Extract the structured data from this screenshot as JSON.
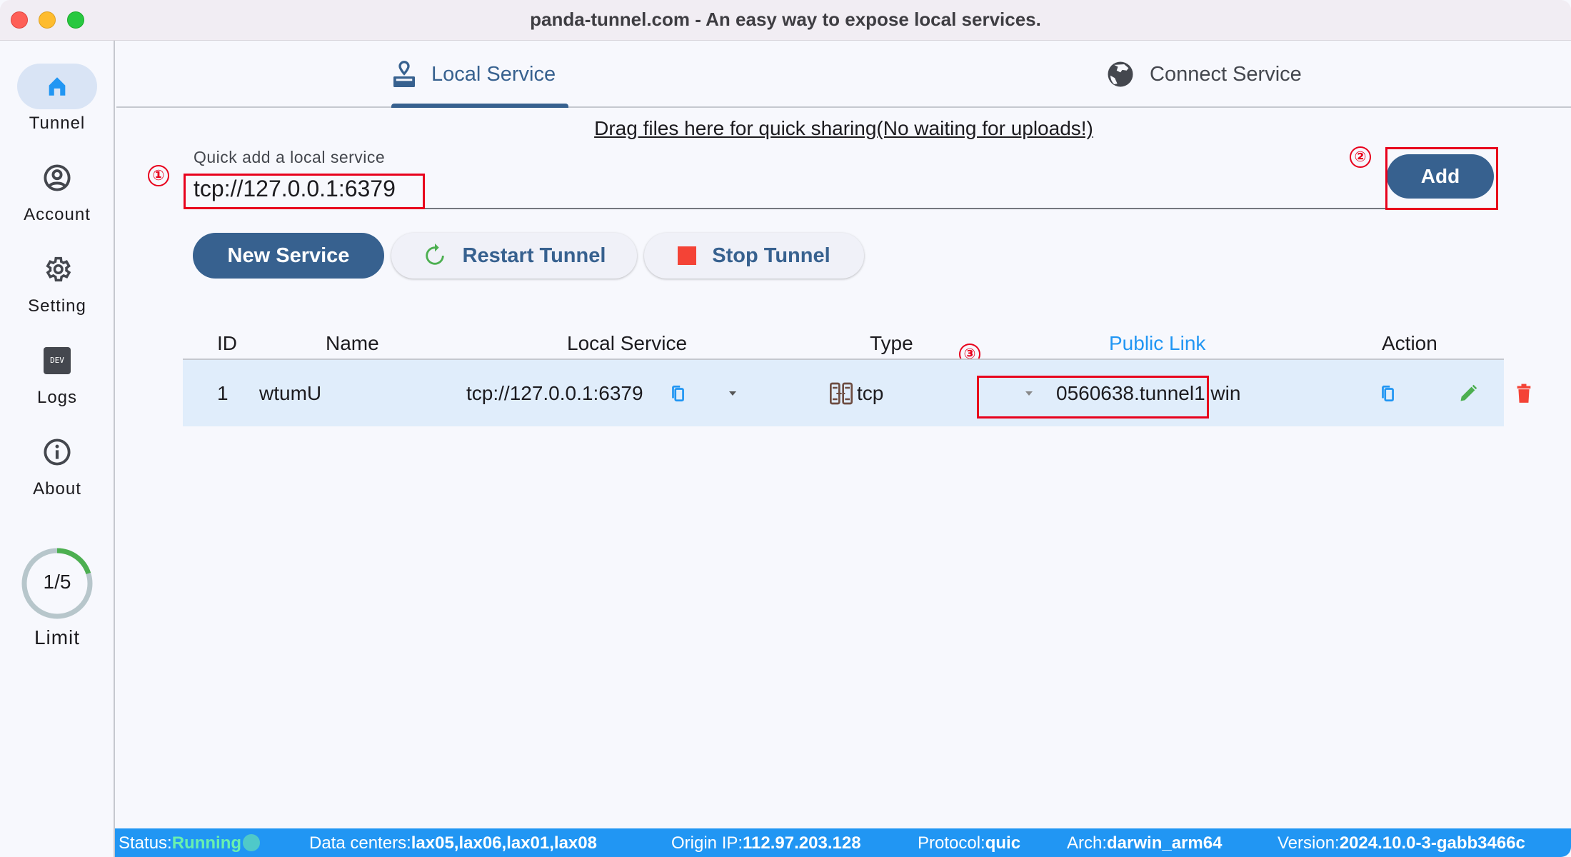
{
  "window": {
    "title": "panda-tunnel.com - An easy way to expose local services."
  },
  "sidebar": {
    "items": [
      {
        "label": "Tunnel",
        "icon": "home-icon",
        "active": true
      },
      {
        "label": "Account",
        "icon": "account-circle-icon",
        "active": false
      },
      {
        "label": "Setting",
        "icon": "gear-icon",
        "active": false
      },
      {
        "label": "Logs",
        "icon": "dev-icon",
        "active": false,
        "icon_text": "DEV"
      },
      {
        "label": "About",
        "icon": "info-icon",
        "active": false
      }
    ],
    "limit": {
      "text": "1/5",
      "label": "Limit",
      "used": 1,
      "total": 5
    }
  },
  "tabs": [
    {
      "label": "Local Service",
      "icon": "stamp-pin-icon",
      "active": true
    },
    {
      "label": "Connect Service",
      "icon": "globe-icon",
      "active": false
    }
  ],
  "drag_text": "Drag files here for quick sharing(No waiting for uploads!)",
  "quick_add": {
    "label": "Quick add a local service",
    "value": "tcp://127.0.0.1:6379",
    "add_label": "Add"
  },
  "markers": [
    "①",
    "②",
    "③"
  ],
  "actions": {
    "new_service": "New Service",
    "restart_tunnel": "Restart Tunnel",
    "stop_tunnel": "Stop Tunnel"
  },
  "table": {
    "columns": [
      "ID",
      "Name",
      "Local Service",
      "Type",
      "Public Link",
      "Action"
    ],
    "rows": [
      {
        "id": "1",
        "name": "wtumU",
        "local_service": "tcp://127.0.0.1:6379",
        "type": "tcp",
        "public_link": "0560638.tunnel1.win"
      }
    ]
  },
  "status_bar": {
    "status_label": "Status:",
    "status_value": "Running",
    "data_centers_label": "Data centers:",
    "data_centers_value": "lax05,lax06,lax01,lax08",
    "origin_ip_label": "Origin IP:",
    "origin_ip_value": "112.97.203.128",
    "protocol_label": "Protocol:",
    "protocol_value": "quic",
    "arch_label": "Arch:",
    "arch_value": "darwin_arm64",
    "version_label": "Version:",
    "version_value": "2024.10.0-3-gabb3466c"
  },
  "colors": {
    "primary": "#37618f",
    "status_bar": "#2196f3",
    "running": "#69f0ae",
    "delete": "#f44336",
    "edit": "#4caf50",
    "highlight": "#e8001c"
  }
}
